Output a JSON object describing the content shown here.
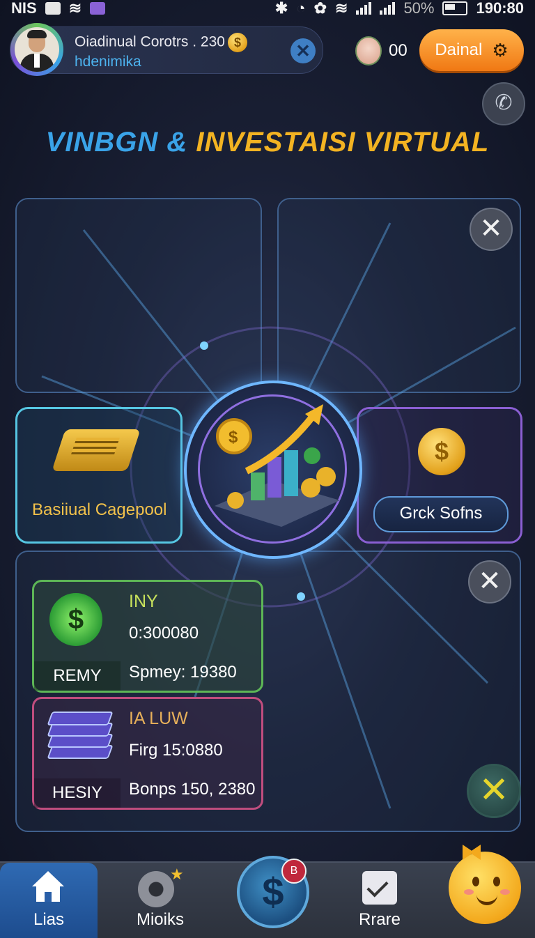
{
  "status_bar": {
    "carrier": "NIS",
    "battery": "50%",
    "time": "190:80"
  },
  "profile": {
    "name": "Oiadinual Corotrs . 230",
    "username": "hdenimika",
    "close_icon": "close-icon"
  },
  "lives": {
    "count": "00"
  },
  "daily_button": {
    "label": "Dainal"
  },
  "title": {
    "part_a": "VINBGN",
    "amp": " & ",
    "part_b": "INVESTAISI VIRTUAL"
  },
  "vault": {
    "label": "Basiiual Cagepool"
  },
  "stock_button": {
    "label": "Grck Sofns"
  },
  "cards": [
    {
      "tag": "REMY",
      "title": "INY",
      "value": "0:300080",
      "sub": "Spmey: 19380",
      "icon": "dollar-badge-icon"
    },
    {
      "tag": "HESIY",
      "title": "IA LUW",
      "value": "Firg 15:0880",
      "sub": "Bonps 150, 2380",
      "icon": "books-icon"
    }
  ],
  "nav": {
    "items": [
      {
        "label": "Lias",
        "icon": "home-icon"
      },
      {
        "label": "Mioiks",
        "icon": "disc-icon"
      },
      {
        "label": "",
        "icon": "dollar-coin-icon"
      },
      {
        "label": "Rrare",
        "icon": "mail-icon"
      },
      {
        "label": "",
        "icon": "mascot-icon"
      }
    ],
    "notification_badge": "B"
  },
  "colors": {
    "accent_blue": "#3aa3e8",
    "accent_gold": "#f3b322",
    "orange_button": "#f07813"
  }
}
